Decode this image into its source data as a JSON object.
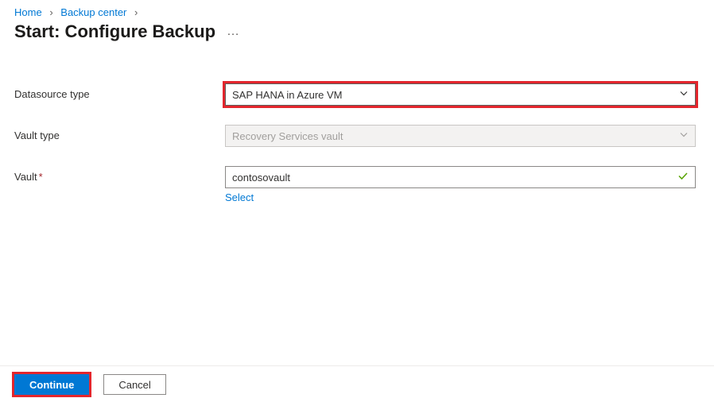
{
  "breadcrumb": {
    "home": "Home",
    "backup_center": "Backup center"
  },
  "page_title": "Start: Configure Backup",
  "title_more": "…",
  "labels": {
    "datasource_type": "Datasource type",
    "vault_type": "Vault type",
    "vault": "Vault"
  },
  "fields": {
    "datasource_type_value": "SAP HANA in Azure VM",
    "vault_type_value": "Recovery Services vault",
    "vault_value": "contosovault"
  },
  "links": {
    "select": "Select"
  },
  "buttons": {
    "continue": "Continue",
    "cancel": "Cancel"
  }
}
